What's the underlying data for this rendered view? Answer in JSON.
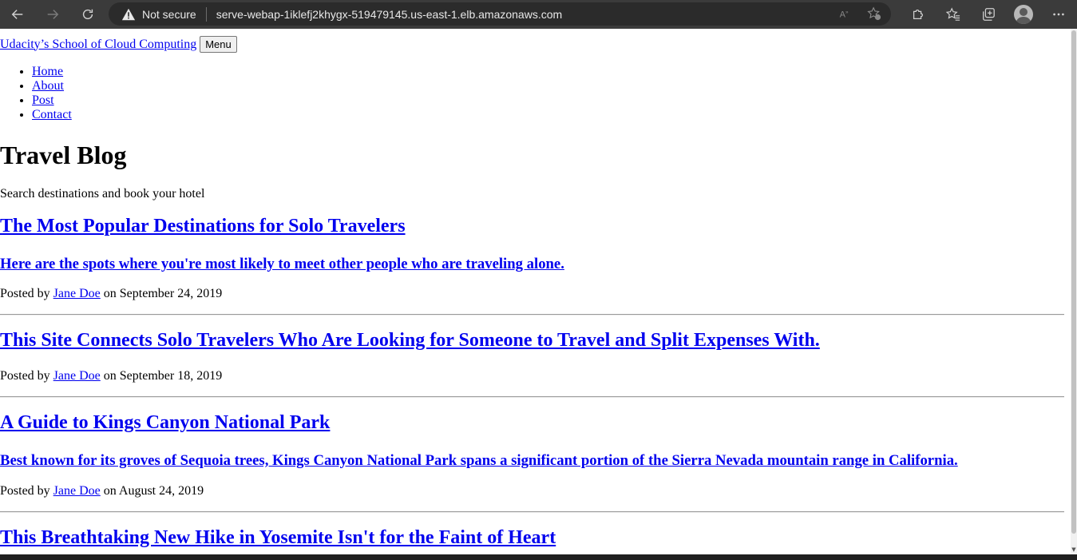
{
  "browser": {
    "security_label": "Not secure",
    "url": "serve-webap-1iklefj2khygx-519479145.us-east-1.elb.amazonaws.com"
  },
  "site": {
    "brand": "Udacity’s School of Cloud Computing",
    "menu_button": "Menu",
    "nav": [
      {
        "label": "Home"
      },
      {
        "label": "About"
      },
      {
        "label": "Post"
      },
      {
        "label": "Contact"
      }
    ],
    "title": "Travel Blog",
    "subtitle": "Search destinations and book your hotel"
  },
  "posts": [
    {
      "title": "The Most Popular Destinations for Solo Travelers",
      "subtitle": "Here are the spots where you're most likely to meet other people who are traveling alone.",
      "meta_prefix": "Posted by",
      "author": "Jane Doe",
      "meta_suffix": "on September 24, 2019"
    },
    {
      "title": "This Site Connects Solo Travelers Who Are Looking for Someone to Travel and Split Expenses With.",
      "subtitle": "",
      "meta_prefix": "Posted by",
      "author": "Jane Doe",
      "meta_suffix": "on September 18, 2019"
    },
    {
      "title": "A Guide to Kings Canyon National Park",
      "subtitle": "Best known for its groves of Sequoia trees, Kings Canyon National Park spans a significant portion of the Sierra Nevada mountain range in California.",
      "meta_prefix": "Posted by",
      "author": "Jane Doe",
      "meta_suffix": "on August 24, 2019"
    },
    {
      "title": "This Breathtaking New Hike in Yosemite Isn't for the Faint of Heart"
    }
  ]
}
